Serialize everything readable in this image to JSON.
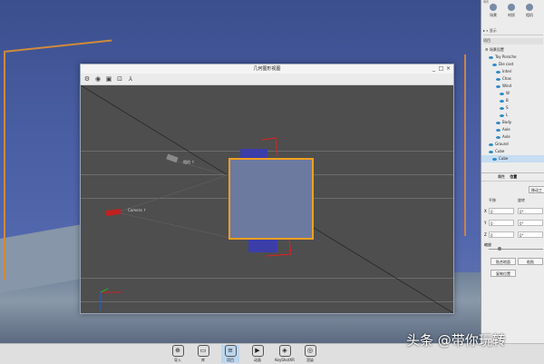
{
  "dialog": {
    "title": "几何图形视图",
    "toolbar": [
      "settings-icon",
      "camera-view-icon",
      "frame-icon",
      "zoom-icon",
      "axis-icon"
    ],
    "window_buttons": [
      "_",
      "□",
      "×"
    ]
  },
  "viewport": {
    "camera_labels": [
      "Camera ↑",
      "相机 ↑"
    ]
  },
  "panel": {
    "tabs": [
      {
        "label": "场景"
      },
      {
        "label": "材质"
      },
      {
        "label": "相机"
      }
    ],
    "header_label": "场景",
    "search_label": "显示",
    "section_label": "项目",
    "tree": [
      "场景设置",
      "Toy Porsche",
      "Die cast",
      "Interi",
      "Chas",
      "Wind",
      "W",
      "B",
      "S",
      "L",
      "Body",
      "Axle",
      "Axle",
      "Ground",
      "Cube",
      "Cube"
    ],
    "prop_tabs": [
      "属性",
      "位置"
    ],
    "move_button": "移动工",
    "translate_label": "平移",
    "rotate_label": "旋转",
    "axes": [
      "X",
      "Y",
      "Z"
    ],
    "translate_values": [
      "0",
      "0",
      "0"
    ],
    "rotate_values": [
      "0°",
      "0°",
      "0°"
    ],
    "scale_label": "缩放",
    "buttons": [
      "贴合地面",
      "复制位置",
      "粘贴"
    ]
  },
  "bottombar": {
    "items": [
      {
        "label": "导入",
        "icon": "⊕"
      },
      {
        "label": "库",
        "icon": "▭"
      },
      {
        "label": "项目",
        "icon": "≡"
      },
      {
        "label": "动画",
        "icon": "▶"
      },
      {
        "label": "KeyShotXR",
        "icon": "◈"
      },
      {
        "label": "渲染",
        "icon": "◎"
      }
    ]
  },
  "watermark": "头条 @带你玩转",
  "colors": {
    "accent": "#f0a020",
    "viewport": "#4e4e4e",
    "sky": "#4a5ea3"
  }
}
